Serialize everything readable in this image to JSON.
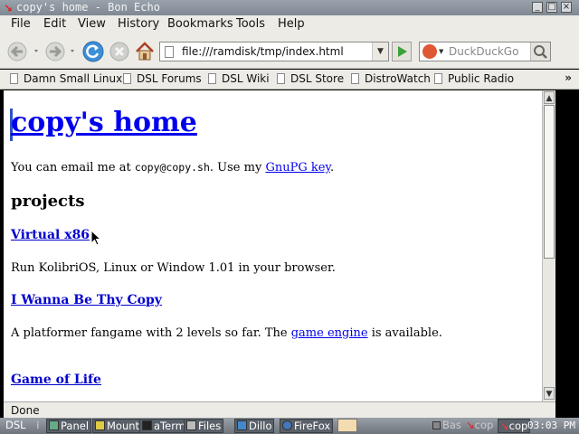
{
  "window": {
    "title": "copy's home - Bon Echo",
    "title_icon": "swirl-icon",
    "buttons": [
      "_",
      "□",
      "×"
    ]
  },
  "menu": [
    {
      "label": "File"
    },
    {
      "label": "Edit"
    },
    {
      "label": "View"
    },
    {
      "label": "History"
    },
    {
      "label": "Bookmarks"
    },
    {
      "label": "Tools"
    },
    {
      "label": "Help"
    }
  ],
  "toolbar": {
    "url": "file:///ramdisk/tmp/index.html",
    "search_placeholder": "DuckDuckGo",
    "back_icon": "back-arrow-icon",
    "forward_icon": "forward-arrow-icon",
    "reload_icon": "reload-icon",
    "stop_icon": "stop-icon",
    "home_icon": "home-icon"
  },
  "bookmarks": [
    {
      "label": "Damn Small Linux"
    },
    {
      "label": "DSL Forums"
    },
    {
      "label": "DSL Wiki"
    },
    {
      "label": "DSL Store"
    },
    {
      "label": "DistroWatch"
    },
    {
      "label": "Public Radio"
    }
  ],
  "bookmarks_more": "»",
  "page": {
    "title": "copy's home",
    "email_prefix": "You can email me at ",
    "email": "copy@copy.sh",
    "email_mid": ". Use my ",
    "gpg_link": "GnuPG key",
    "email_suffix": ".",
    "projects_heading": "projects",
    "project1_link": "Virtual x86",
    "project1_desc": "Run KolibriOS, Linux or Window 1.01 in your browser.",
    "project2_link": "I Wanna Be Thy Copy",
    "project2_desc_prefix": "A platformer fangame with 2 levels so far. The ",
    "project2_engine_link": "game engine",
    "project2_desc_suffix": " is available.",
    "project3_link": "Game of Life"
  },
  "status": "Done",
  "taskbar": {
    "start": "DSL",
    "tasks": [
      {
        "label": "Panel"
      },
      {
        "label": "Mount"
      },
      {
        "label": "aTerm"
      },
      {
        "label": "Files"
      },
      {
        "label": "Dillo"
      },
      {
        "label": "FireFox"
      }
    ],
    "tray1": "Bas",
    "tray2": "cop",
    "tray3": "cop",
    "clock": "03:03 PM"
  },
  "colors": {
    "link": "#0000ee",
    "chrome": "#ecebe6",
    "titlebar": "#8a929c"
  }
}
